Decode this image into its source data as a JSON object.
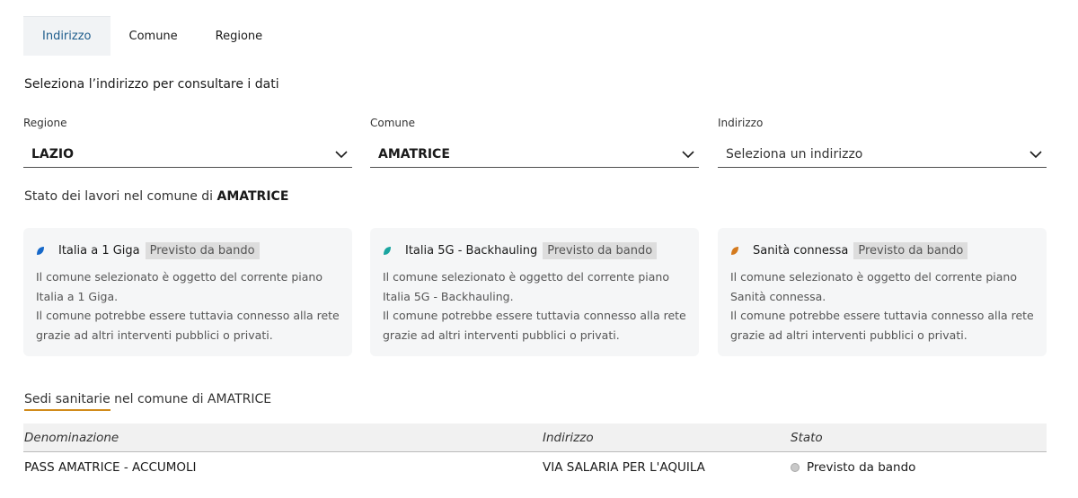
{
  "tabs": [
    {
      "label": "Indirizzo",
      "active": true
    },
    {
      "label": "Comune",
      "active": false
    },
    {
      "label": "Regione",
      "active": false
    }
  ],
  "intro": "Seleziona l’indirizzo per consultare i dati",
  "selects": {
    "regione": {
      "label": "Regione",
      "value": "LAZIO"
    },
    "comune": {
      "label": "Comune",
      "value": "AMATRICE"
    },
    "indirizzo": {
      "label": "Indirizzo",
      "value": "Seleziona un indirizzo"
    }
  },
  "status": {
    "prefix": "Stato dei lavori nel comune di ",
    "comune": "AMATRICE"
  },
  "cards": [
    {
      "name": "Italia a 1 Giga",
      "badge": "Previsto da bando",
      "icon_color": "#1668c9",
      "line1": "Il comune selezionato è oggetto del corrente piano Italia a 1 Giga.",
      "line2": "Il comune potrebbe essere tuttavia connesso alla rete grazie ad altri interventi pubblici o privati."
    },
    {
      "name": "Italia 5G - Backhauling",
      "badge": "Previsto da bando",
      "icon_color": "#1aa5a0",
      "line1": "Il comune selezionato è oggetto del corrente piano Italia 5G - Backhauling.",
      "line2": "Il comune potrebbe essere tuttavia connesso alla rete grazie ad altri interventi pubblici o privati."
    },
    {
      "name": "Sanità connessa",
      "badge": "Previsto da bando",
      "icon_color": "#d47a1e",
      "line1": "Il comune selezionato è oggetto del corrente piano Sanità connessa.",
      "line2": "Il comune potrebbe essere tuttavia connesso alla rete grazie ad altri interventi pubblici o privati."
    }
  ],
  "sedi": {
    "title_link": "Sedi sanitarie",
    "title_rest": " nel comune di AMATRICE",
    "accent_color": "#d18b1a",
    "columns": [
      "Denominazione",
      "Indirizzo",
      "Stato"
    ],
    "rows": [
      {
        "denominazione": "PASS AMATRICE - ACCUMOLI",
        "indirizzo": "VIA SALARIA PER L'AQUILA",
        "stato": "Previsto da bando"
      }
    ]
  },
  "icons": {
    "dropdown": "chevron-down-icon",
    "card": "leaf-icon",
    "status": "status-dot-icon"
  }
}
